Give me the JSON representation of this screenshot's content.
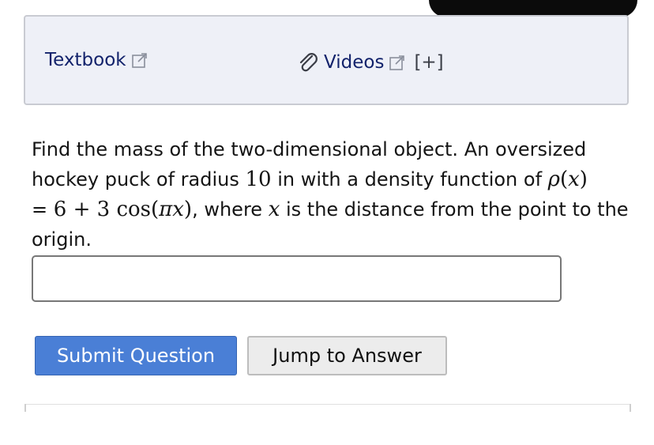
{
  "resources": {
    "textbook_label": "Textbook",
    "videos_label": "Videos",
    "expand_label": "[+]"
  },
  "question": {
    "intro": "Find the mass of the two-dimensional object. An oversized hockey puck of radius ",
    "radius_value": "10",
    "mid": " in with a density function of ",
    "rho": "ρ",
    "var_x": "x",
    "eq_sign": "=",
    "c1": "6",
    "plus": "+",
    "c2": "3",
    "cos": "cos",
    "pi": "π",
    "var_x2": "x",
    "tail1": ", where ",
    "var_x3": "x",
    "tail2": " is the distance from the point to the origin."
  },
  "answer": {
    "value": "",
    "placeholder": ""
  },
  "buttons": {
    "submit": "Submit Question",
    "jump": "Jump to Answer"
  },
  "icons": {
    "external": "external-link-icon",
    "paperclip": "paperclip-icon"
  },
  "colors": {
    "link": "#12226b",
    "submit_bg": "#4a7fd6",
    "resource_bg": "#eef0f7"
  }
}
